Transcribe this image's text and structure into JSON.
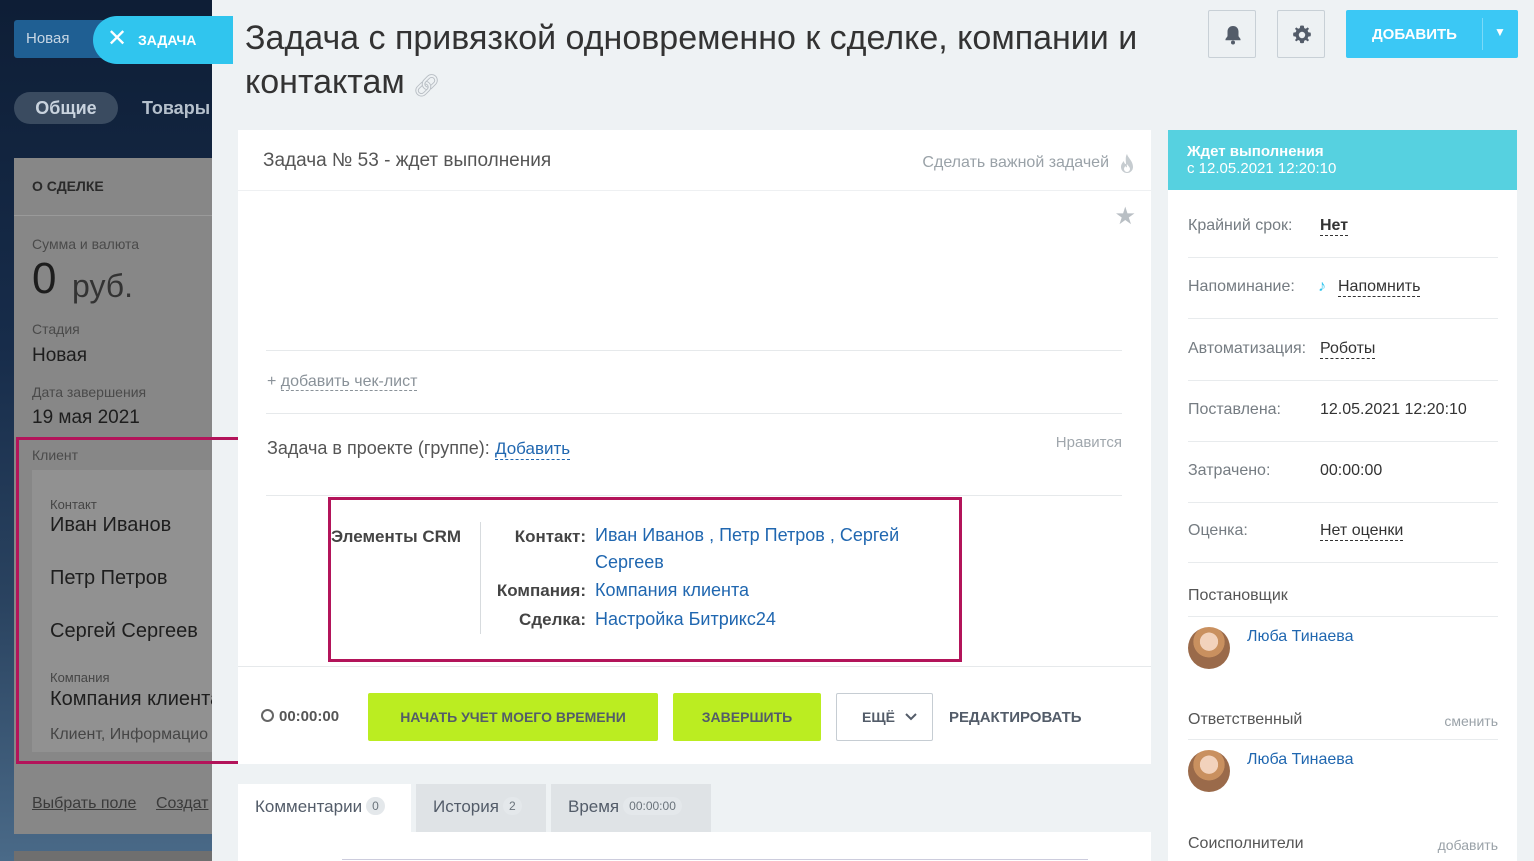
{
  "deal": {
    "stage_label": "Новая",
    "tabs": [
      "Общие",
      "Товары"
    ],
    "section_title": "О СДЕЛКЕ",
    "amount_label": "Сумма и валюта",
    "amount_value": "0",
    "amount_currency": "руб.",
    "stage_field_label": "Стадия",
    "stage_field_value": "Новая",
    "close_date_label": "Дата завершения",
    "close_date_value": "19 мая 2021",
    "client_label": "Клиент",
    "contact_label": "Контакт",
    "contacts": [
      "Иван Иванов",
      "Петр Петров",
      "Сергей Сергеев"
    ],
    "company_label": "Компания",
    "company_value": "Компания клиента",
    "company_sub": "Клиент, Информацио",
    "footer_links": [
      "Выбрать поле",
      "Создат"
    ]
  },
  "task_tab": {
    "label": "ЗАДАЧА"
  },
  "header": {
    "title": "Задача с привязкой одновременно к сделке, компании и контактам",
    "add_button": "ДОБАВИТЬ"
  },
  "task": {
    "heading": "Задача № 53 - ждет выполнения",
    "make_important": "Сделать важной задачей",
    "checklist_link": "добавить чек-лист",
    "checklist_prefix": "+",
    "project_label": "Задача в проекте (группе):",
    "project_add": "Добавить",
    "likes": "Нравится",
    "crm_title": "Элементы CRM",
    "crm_contact_label": "Контакт:",
    "crm_contacts_line1": "Иван Иванов , Петр Петров , Сергей",
    "crm_contacts_line2": "Сергеев",
    "crm_company_label": "Компания:",
    "crm_company": "Компания клиента",
    "crm_deal_label": "Сделка:",
    "crm_deal": "Настройка Битрикс24",
    "timer": "00:00:00",
    "start_button": "НАЧАТЬ УЧЕТ МОЕГО ВРЕМЕНИ",
    "finish_button": "ЗАВЕРШИТЬ",
    "more_button": "ЕЩЁ",
    "edit_button": "РЕДАКТИРОВАТЬ"
  },
  "tabs": [
    {
      "label": "Комментарии",
      "count": "0"
    },
    {
      "label": "История",
      "count": "2"
    },
    {
      "label": "Время",
      "count": "00:00:00"
    }
  ],
  "sidebar": {
    "status_title": "Ждет выполнения",
    "status_since": "с 12.05.2021 12:20:10",
    "deadline_label": "Крайний срок:",
    "deadline_value": "Нет",
    "reminder_label": "Напоминание:",
    "reminder_value": "Напомнить",
    "automation_label": "Автоматизация:",
    "automation_value": "Роботы",
    "created_label": "Поставлена:",
    "created_value": "12.05.2021 12:20:10",
    "spent_label": "Затрачено:",
    "spent_value": "00:00:00",
    "rating_label": "Оценка:",
    "rating_value": "Нет оценки",
    "creator_label": "Постановщик",
    "creator_name": "Люба Тинаева",
    "responsible_label": "Ответственный",
    "responsible_change": "сменить",
    "responsible_name": "Люба Тинаева",
    "coexec_label": "Соисполнители",
    "coexec_add": "добавить"
  },
  "colors": {
    "accent": "#3bc8f5",
    "status": "#56d1e0",
    "green_button": "#bbed21",
    "highlight_frame": "#b3145a",
    "link": "#2067b0"
  }
}
